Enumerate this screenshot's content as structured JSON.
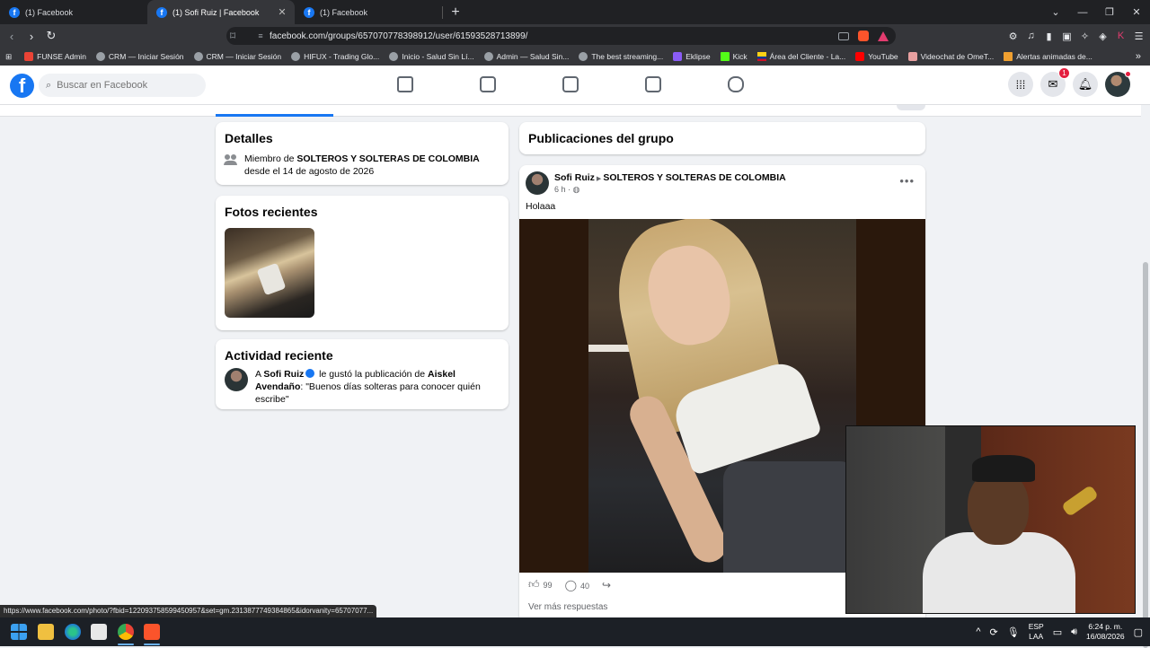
{
  "browser": {
    "tabs": [
      {
        "title": "(1) Facebook",
        "active": false
      },
      {
        "title": "(1) Sofi Ruiz | Facebook",
        "active": true
      },
      {
        "title": "(1) Facebook",
        "active": false
      }
    ],
    "url": "facebook.com/groups/657070778398912/user/61593528713899/",
    "bookmarks": [
      {
        "label": "FUNSE Admin",
        "icon": "gmail-icon"
      },
      {
        "label": "CRM — Iniciar Sesión",
        "icon": "globe-icon"
      },
      {
        "label": "CRM — Iniciar Sesión",
        "icon": "globe-icon"
      },
      {
        "label": "HIFUX - Trading Glo...",
        "icon": "globe-icon"
      },
      {
        "label": "Inicio - Salud Sin Lí...",
        "icon": "globe-icon"
      },
      {
        "label": "Admin — Salud Sin...",
        "icon": "globe-icon"
      },
      {
        "label": "The best streaming...",
        "icon": "diamond-icon"
      },
      {
        "label": "Eklipse",
        "icon": "eklipse-icon"
      },
      {
        "label": "Kick",
        "icon": "kick-icon"
      },
      {
        "label": "Área del Cliente - La...",
        "icon": "flag-icon"
      },
      {
        "label": "YouTube",
        "icon": "youtube-icon"
      },
      {
        "label": "Videochat de OmeT...",
        "icon": "omegle-icon"
      },
      {
        "label": "Alertas animadas de...",
        "icon": "alert-icon"
      }
    ],
    "status_url": "https://www.facebook.com/photo/?fbid=122093758599450957&set=gm.2313877749384865&idorvanity=65707077..."
  },
  "facebook": {
    "search_placeholder": "Buscar en Facebook",
    "messenger_badge": "1",
    "details": {
      "title": "Detalles",
      "member_prefix": "Miembro de ",
      "group_name": "SOLTEROS Y SOLTERAS DE COLOMBIA",
      "member_suffix": " desde el 14 de agosto de 2026"
    },
    "recent_photos": {
      "title": "Fotos recientes"
    },
    "activity": {
      "title": "Actividad reciente",
      "prefix": "A ",
      "user": "Sofi Ruiz",
      "middle": " le gustó la publicación de ",
      "other_user": "Aiskel Avendaño",
      "quote": ": \"Buenos días solteras para conocer quién escribe\""
    },
    "group_posts": {
      "title": "Publicaciones del grupo"
    },
    "post": {
      "author": "Sofi Ruiz",
      "group": "SOLTEROS Y SOLTERAS DE COLOMBIA",
      "time": "6 h ·",
      "text": "Holaaa",
      "likes": "99",
      "comments": "40",
      "see_more": "Ver más respuestas"
    }
  },
  "taskbar": {
    "lang_top": "ESP",
    "lang_bottom": "LAA",
    "time": "6:24 p. m.",
    "date": "16/08/2026"
  },
  "colors": {
    "fb_blue": "#1877f2",
    "chrome_dark": "#202124",
    "taskbar": "#1c2026"
  }
}
